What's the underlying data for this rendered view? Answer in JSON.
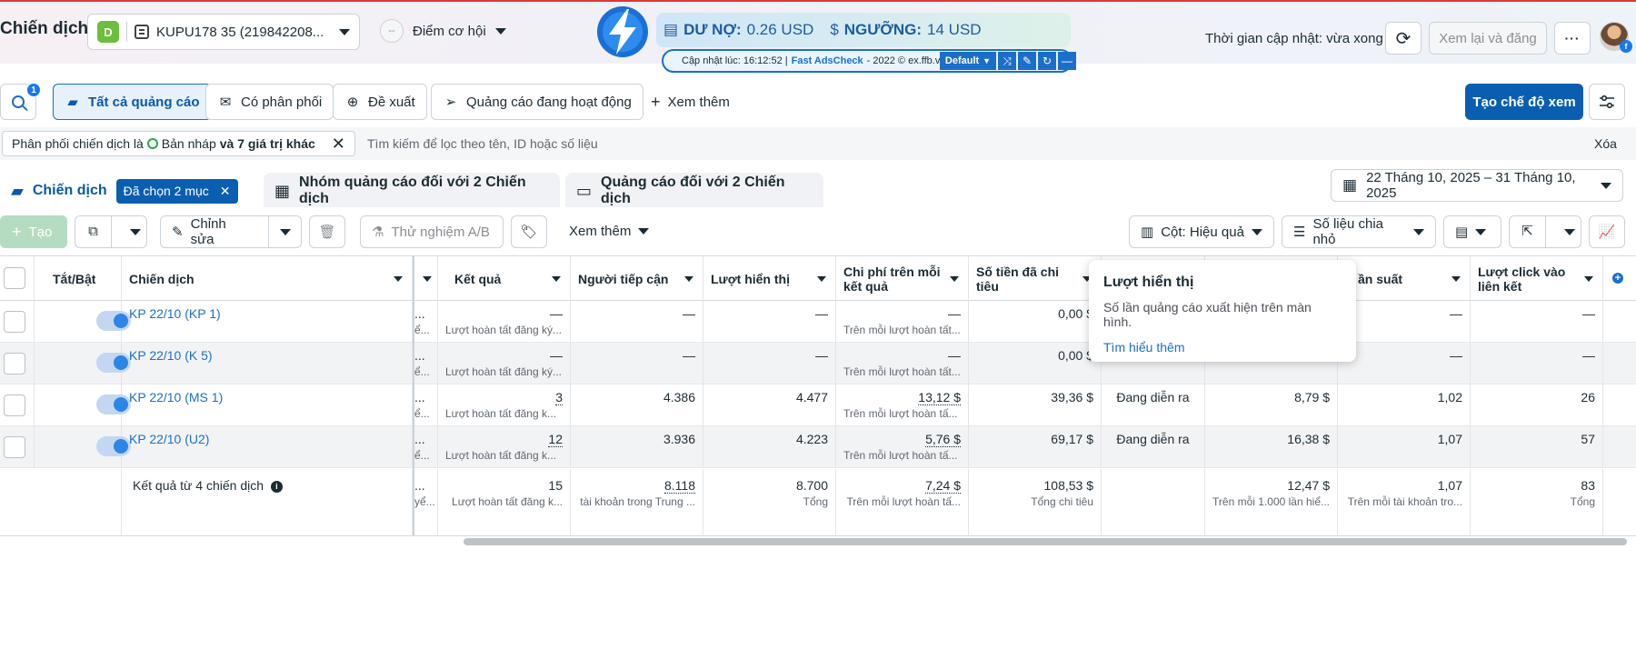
{
  "header": {
    "title": "Chiến dịch",
    "account_badge": "D",
    "account_name": "KUPU178 35 (219842208...",
    "opportunity_score": "--",
    "opportunity_label": "Điểm cơ hội",
    "update_time": "Thời gian cập nhật: vừa xong",
    "review_button": "Xem lại và đăng"
  },
  "extension": {
    "debt_label": "DƯ NỢ:",
    "debt_value": "0.26 USD",
    "threshold_label": "NGƯỠNG:",
    "threshold_value": "14 USD",
    "updated_prefix": "Cập nhật lúc: 16:12:52 |",
    "brand": "Fast AdsCheck",
    "copyright": "- 2022 © ex.ffb.vn",
    "profile": "Default"
  },
  "filter_tabs": {
    "search_badge": "1",
    "items": [
      "Tất cả quảng cáo",
      "Có phân phối",
      "Đề xuất",
      "Quảng cáo đang hoạt động"
    ],
    "more": "Xem thêm",
    "create_view": "Tạo chế độ xem"
  },
  "filterbar": {
    "chip_prefix": "Phân phối chiến dịch là",
    "chip_value": "Bản nháp",
    "chip_more": "và 7 giá trị khác",
    "placeholder": "Tìm kiếm để lọc theo tên, ID hoặc số liệu",
    "clear": "Xóa"
  },
  "tabs": {
    "campaign": "Chiến dịch",
    "selected": "Đã chọn 2 mục",
    "adsets": "Nhóm quảng cáo đối với 2 Chiến dịch",
    "ads": "Quảng cáo đối với 2 Chiến dịch",
    "date_range": "22 Tháng 10, 2025 – 31 Tháng 10, 2025"
  },
  "toolbar": {
    "create": "Tạo",
    "edit": "Chỉnh sửa",
    "ab_test": "Thử nghiệm A/B",
    "more": "Xem thêm",
    "columns": "Cột: Hiệu quả",
    "breakdown": "Số liệu chia nhỏ"
  },
  "columns": {
    "toggle": "Tắt/Bật",
    "campaign": "Chiến dịch",
    "results": "Kết quả",
    "reach": "Người tiếp cận",
    "impressions": "Lượt hiển thị",
    "cost_per_result": "Chi phí trên mỗi kết quả",
    "spend": "Số tiền đã chi tiêu",
    "frequency": "ần suất",
    "link_clicks": "Lượt click vào liên kết"
  },
  "rows": [
    {
      "name": "KP 22/10 (KP 1)",
      "trunc": "...",
      "trunc_sub": "ể...",
      "results": "—",
      "results_sub": "Lượt hoàn tất đăng ký...",
      "reach": "—",
      "impressions": "—",
      "cpr": "—",
      "cpr_sub": "Trên mỗi lượt hoàn tất...",
      "spend": "0,00 $",
      "delivery": "",
      "cpm": "",
      "frequency": "—",
      "clicks": "—"
    },
    {
      "name": "KP 22/10 (K 5)",
      "trunc": "...",
      "trunc_sub": "ể...",
      "results": "—",
      "results_sub": "Lượt hoàn tất đăng ký...",
      "reach": "—",
      "impressions": "—",
      "cpr": "—",
      "cpr_sub": "Trên mỗi lượt hoàn tất...",
      "spend": "0,00 $",
      "delivery": "",
      "cpm": "",
      "frequency": "—",
      "clicks": "—"
    },
    {
      "name": "KP 22/10 (MS 1)",
      "trunc": "...",
      "trunc_sub": "ể...",
      "results": "3",
      "results_sub": "Lượt hoàn tất đăng k...",
      "reach": "4.386",
      "impressions": "4.477",
      "cpr": "13,12 $",
      "cpr_sub": "Trên mỗi lượt hoàn tấ...",
      "spend": "39,36 $",
      "delivery": "Đang diễn ra",
      "cpm": "8,79 $",
      "frequency": "1,02",
      "clicks": "26"
    },
    {
      "name": "KP 22/10 (U2)",
      "trunc": "...",
      "trunc_sub": "ể...",
      "results": "12",
      "results_sub": "Lượt hoàn tất đăng k...",
      "reach": "3.936",
      "impressions": "4.223",
      "cpr": "5,76 $",
      "cpr_sub": "Trên mỗi lượt hoàn tấ...",
      "spend": "69,17 $",
      "delivery": "Đang diễn ra",
      "cpm": "16,38 $",
      "frequency": "1,07",
      "clicks": "57"
    }
  ],
  "footer": {
    "label": "Kết quả từ 4 chiến dịch",
    "trunc": "...",
    "trunc_sub": "yể...",
    "results": "15",
    "results_sub": "Lượt hoàn tất đăng k...",
    "reach": "8.118",
    "reach_sub": "tài khoản trong Trung ...",
    "impressions": "8.700",
    "impressions_sub": "Tổng",
    "cpr": "7,24 $",
    "cpr_sub": "Trên mỗi lượt hoàn tấ...",
    "spend": "108,53 $",
    "spend_sub": "Tổng chi tiêu",
    "cpm": "12,47 $",
    "cpm_sub": "Trên mỗi 1.000 lần hiể...",
    "frequency": "1,07",
    "frequency_sub": "Trên mỗi tài khoản tro...",
    "clicks": "83",
    "clicks_sub": "Tổng"
  },
  "tooltip": {
    "title": "Lượt hiển thị",
    "body": "Số lần quảng cáo xuất hiện trên màn hình.",
    "link": "Tìm hiểu thêm"
  }
}
